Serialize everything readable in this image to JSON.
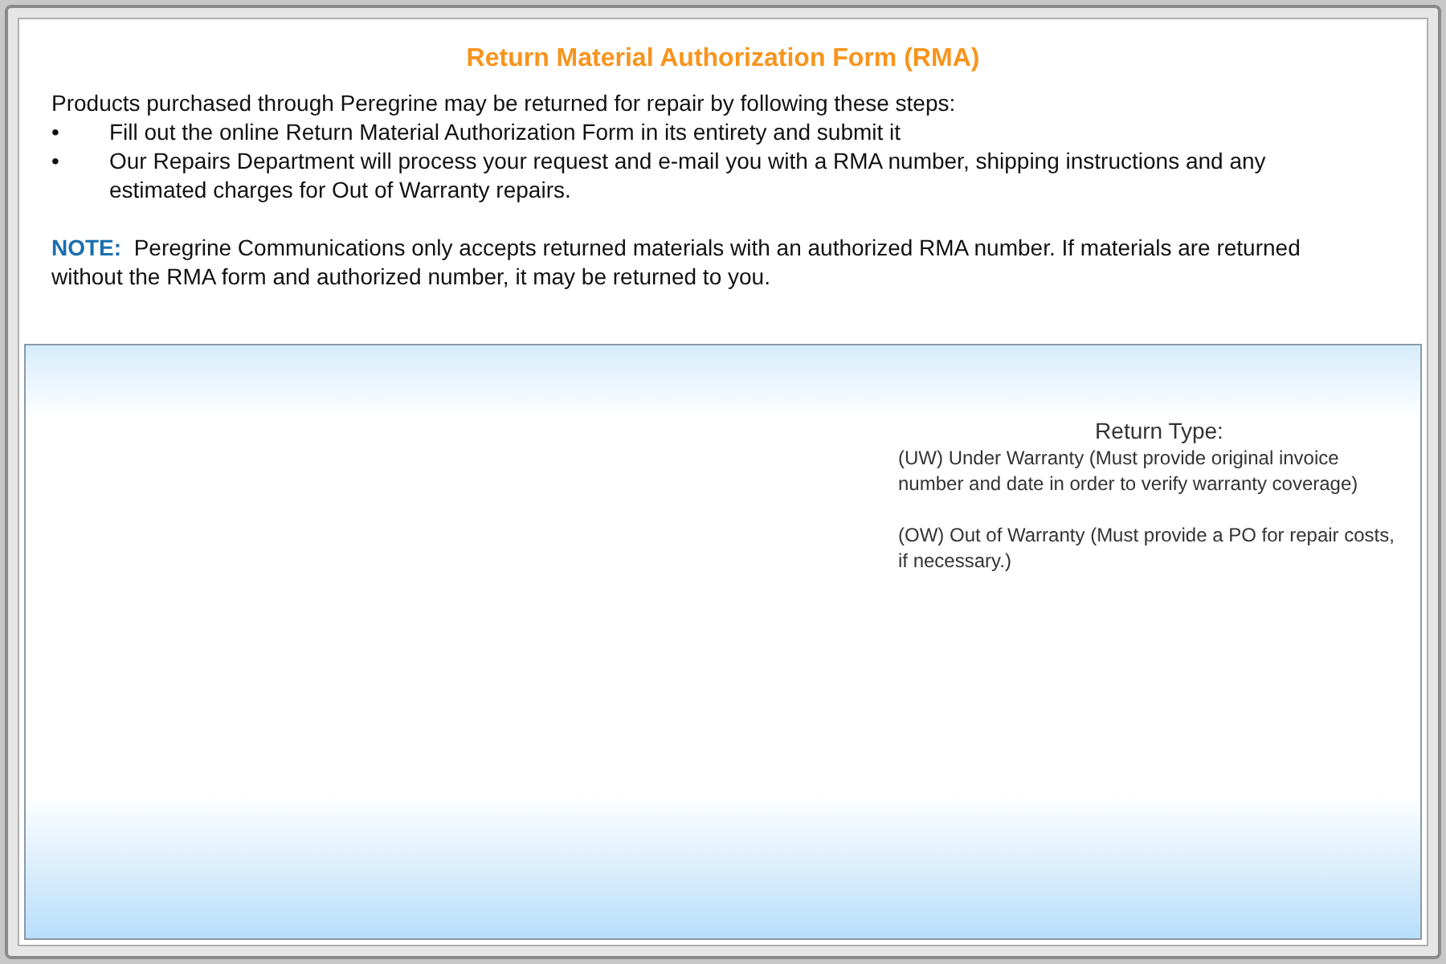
{
  "title": "Return Material Authorization Form (RMA)",
  "intro": "Products purchased through Peregrine may be returned for repair by following these steps:",
  "steps": [
    {
      "bullet": "•",
      "text": "Fill out the online Return Material Authorization Form in its entirety and submit it"
    },
    {
      "bullet": "•",
      "text": "Our Repairs Department will process your request and e-mail you with a RMA number, shipping instructions and any estimated charges for Out of Warranty repairs."
    }
  ],
  "note": {
    "label": "NOTE:",
    "text": "Peregrine Communications only accepts returned materials with an authorized RMA number.  If materials are returned without the RMA form and authorized number, it may be returned to you."
  },
  "return_type": {
    "heading": "Return Type:",
    "options": [
      "(UW) Under Warranty (Must provide original invoice number and date in order to verify warranty coverage)",
      "(OW) Out of Warranty (Must provide a PO for repair costs, if necessary.)"
    ]
  }
}
